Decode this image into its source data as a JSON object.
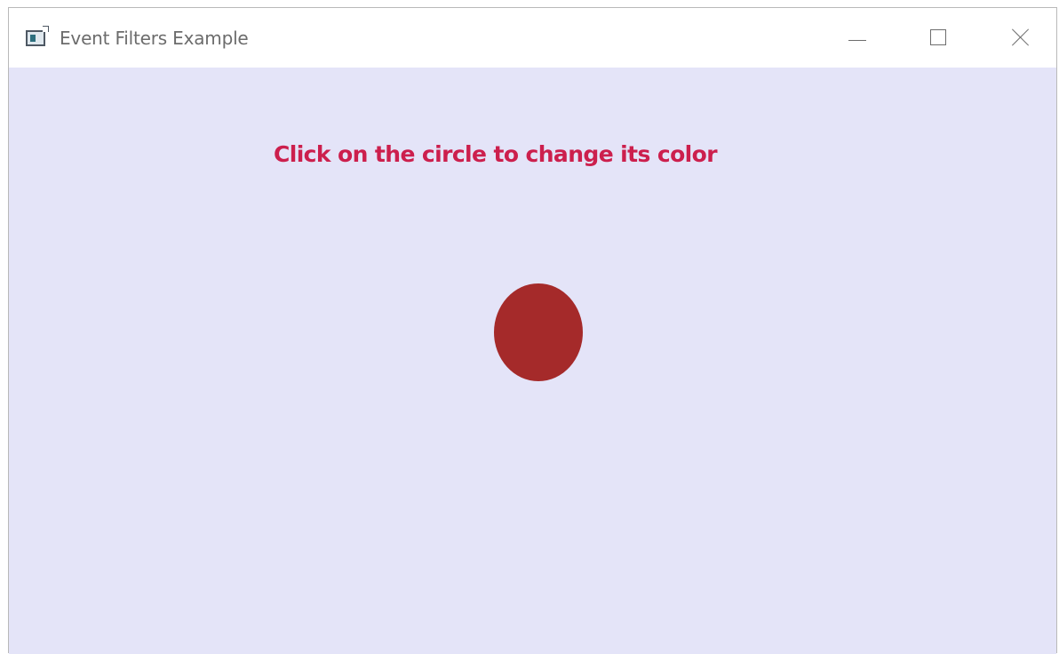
{
  "window": {
    "title": "Event Filters Example",
    "icon": "java-app-icon",
    "controls": {
      "minimize_icon": "minimize-icon",
      "maximize_icon": "maximize-icon",
      "close_icon": "close-icon"
    }
  },
  "content": {
    "background_color": "#e4e4f8",
    "instruction_text": "Click on the circle to change its color",
    "instruction_color": "#cc1f4d",
    "circle_color": "#a52a2a"
  }
}
